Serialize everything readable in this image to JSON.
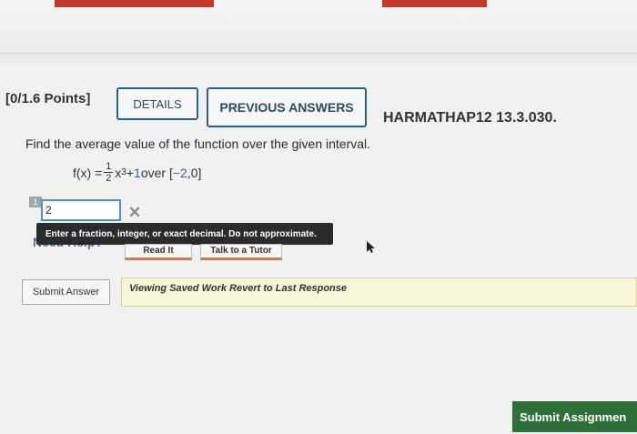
{
  "header": {
    "points": "[0/1.6 Points]",
    "details": "DETAILS",
    "previous_answers": "PREVIOUS ANSWERS",
    "reference": "HARMATHAP12 13.3.030."
  },
  "question": {
    "prompt": "Find the average value of the function over the given interval.",
    "fx": "f(x) =",
    "numerator": "1",
    "denominator": "2",
    "xvar": "x",
    "exponent": "3",
    "plus": " + ",
    "constant": "1",
    "over": " over [",
    "interval_a": "−2",
    "comma": ", ",
    "interval_b": "0",
    "close": "]"
  },
  "answer": {
    "number": "1",
    "value": "2",
    "wrong_mark": "✕",
    "hint": "Enter a fraction, integer, or exact decimal. Do not approximate."
  },
  "help": {
    "need_help": "Need Help?",
    "read_it": "Read It",
    "talk_tutor": "Talk to a Tutor"
  },
  "actions": {
    "submit_answer": "Submit Answer",
    "viewing": "Viewing Saved Work Revert to Last Response",
    "submit_assignment": "Submit Assignmen"
  },
  "colors": {
    "accent_blue": "#2b5f8f",
    "success_green": "#2f6f3a",
    "top_red": "#c6362b"
  }
}
